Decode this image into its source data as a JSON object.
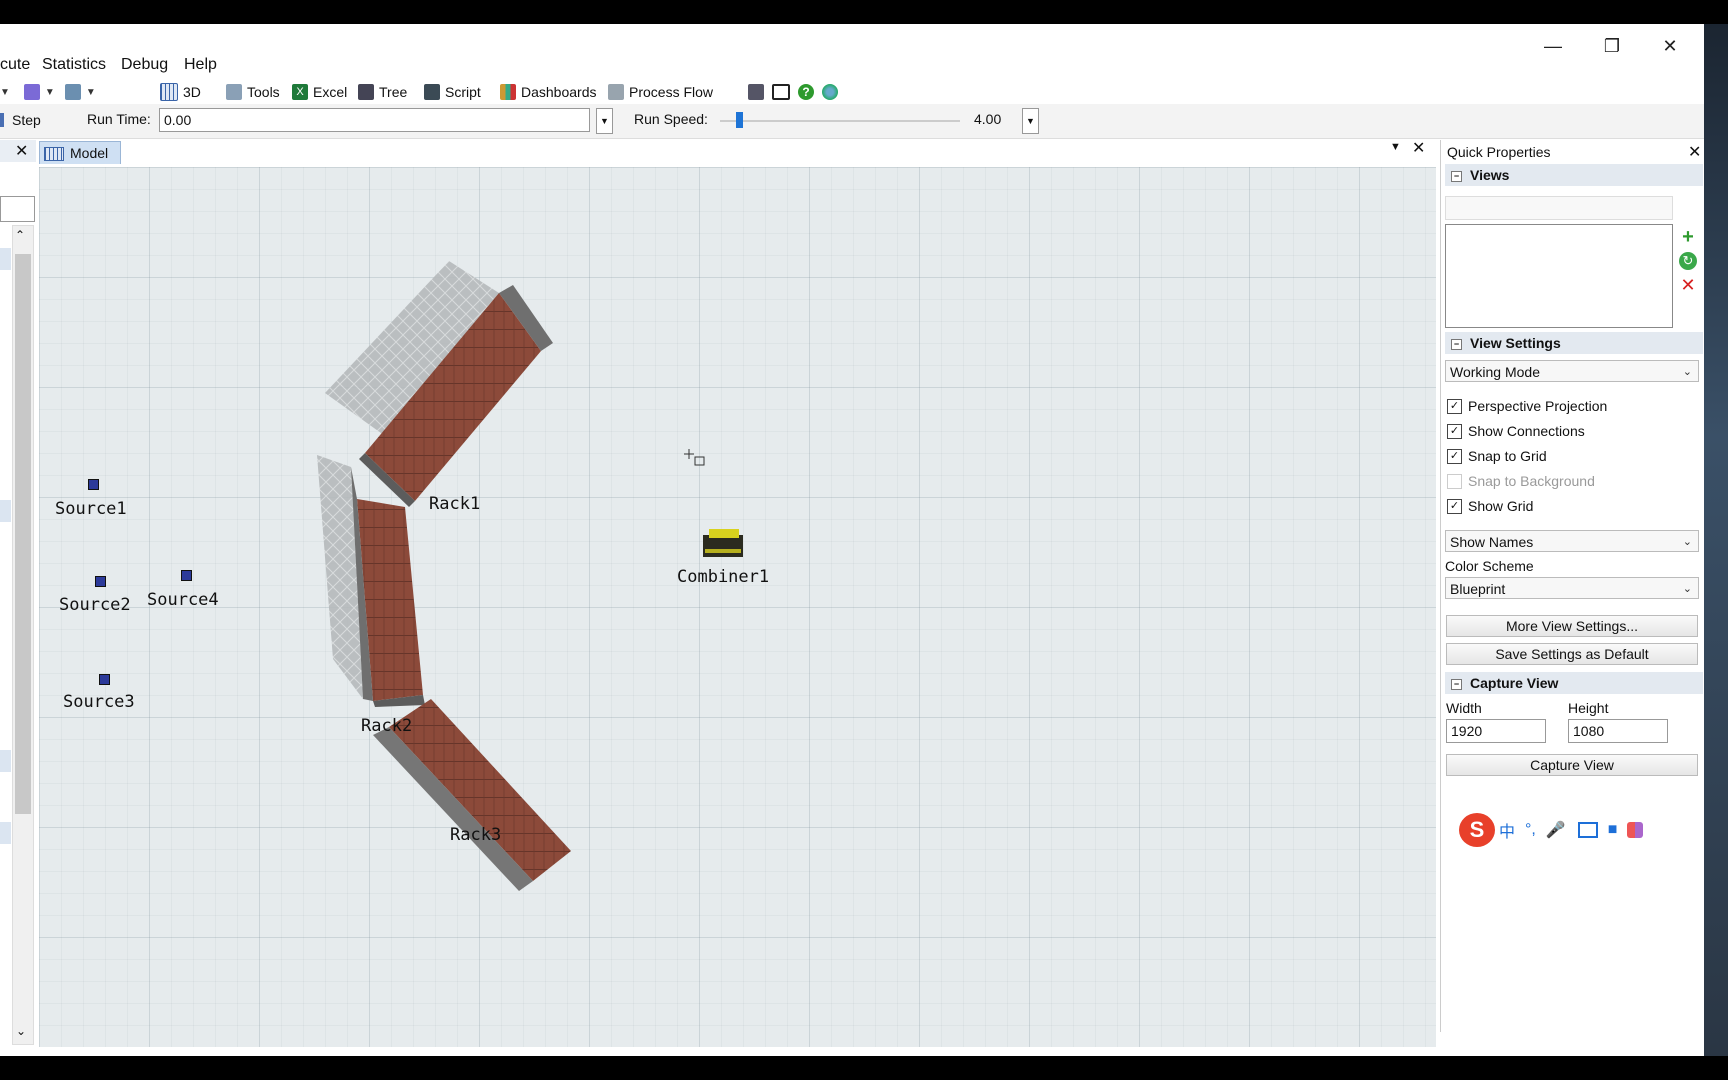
{
  "menu": {
    "items": [
      "cute",
      "Statistics",
      "Debug",
      "Help"
    ]
  },
  "toolbar": {
    "view3d": "3D",
    "tools": "Tools",
    "excel": "Excel",
    "tree": "Tree",
    "script": "Script",
    "dashboards": "Dashboards",
    "process_flow": "Process Flow"
  },
  "runbar": {
    "step": "Step",
    "run_time_label": "Run Time:",
    "run_time_value": "0.00",
    "run_speed_label": "Run Speed:",
    "run_speed_value": "4.00"
  },
  "model_tab": {
    "label": "Model"
  },
  "objects": {
    "rack1": "Rack1",
    "rack2": "Rack2",
    "rack3": "Rack3",
    "source1": "Source1",
    "source2": "Source2",
    "source3": "Source3",
    "source4": "Source4",
    "combiner1": "Combiner1"
  },
  "quick_properties": {
    "title": "Quick Properties",
    "views_section": "Views",
    "view_settings_section": "View Settings",
    "working_mode": "Working Mode",
    "checkboxes": [
      {
        "label": "Perspective Projection",
        "checked": true
      },
      {
        "label": "Show Connections",
        "checked": true
      },
      {
        "label": "Snap to Grid",
        "checked": true
      },
      {
        "label": "Snap to Background",
        "checked": false
      },
      {
        "label": "Show Grid",
        "checked": true
      }
    ],
    "show_names": "Show Names",
    "color_scheme_label": "Color Scheme",
    "color_scheme_value": "Blueprint",
    "more_view_settings": "More View Settings...",
    "save_settings_default": "Save Settings as Default",
    "capture_view_section": "Capture View",
    "width_label": "Width",
    "width_value": "1920",
    "height_label": "Height",
    "height_value": "1080",
    "capture_view_button": "Capture View"
  },
  "ime_bar": {
    "chinese_label": "中",
    "punct_label": "°,"
  },
  "colors": {
    "rack_brown": "#8c4a3a",
    "grid_bg": "#e6ebed",
    "source_blue": "#2c3a9a",
    "combiner_yellow": "#d9d21e"
  }
}
